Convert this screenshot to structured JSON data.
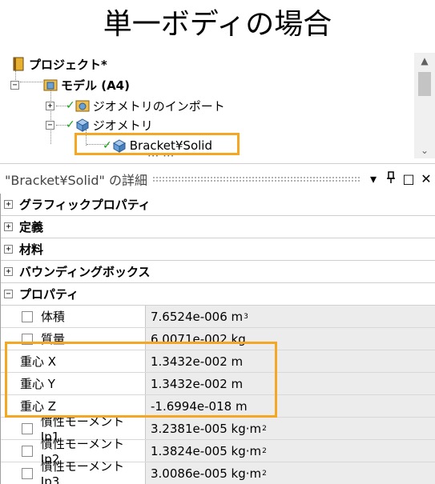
{
  "page_title": "単一ボディの場合",
  "tree": {
    "project": "プロジェクト*",
    "model": "モデル (A4)",
    "geometry_import": "ジオメトリのインポート",
    "geometry": "ジオメトリ",
    "body": "Bracket¥Solid",
    "partial_next": "··· ···"
  },
  "details": {
    "title": "\"Bracket¥Solid\" の詳細",
    "buttons": {
      "dropdown": "▾",
      "pin": "ᛘ",
      "maximize": "□",
      "close": "✕"
    }
  },
  "categories": [
    {
      "label": "グラフィックプロパティ",
      "toggle": "+"
    },
    {
      "label": "定義",
      "toggle": "+"
    },
    {
      "label": "材料",
      "toggle": "+"
    },
    {
      "label": "バウンディングボックス",
      "toggle": "+"
    },
    {
      "label": "プロパティ",
      "toggle": "−"
    }
  ],
  "properties": [
    {
      "name": "体積",
      "value": "7.6524e-006 m",
      "sup": "3",
      "checkbox": true
    },
    {
      "name": "質量",
      "value": "6.0071e-002 kg",
      "sup": "",
      "checkbox": true
    },
    {
      "name": "重心 X",
      "value": "1.3432e-002 m",
      "sup": "",
      "checkbox": false
    },
    {
      "name": "重心 Y",
      "value": "1.3432e-002 m",
      "sup": "",
      "checkbox": false
    },
    {
      "name": "重心 Z",
      "value": "-1.6994e-018 m",
      "sup": "",
      "checkbox": false
    },
    {
      "name": "慣性モーメント Ip1",
      "value": "3.2381e-005 kg·m",
      "sup": "2",
      "checkbox": true
    },
    {
      "name": "慣性モーメント Ip2",
      "value": "1.3824e-005 kg·m",
      "sup": "2",
      "checkbox": true
    },
    {
      "name": "慣性モーメント Ip3",
      "value": "3.0086e-005 kg·m",
      "sup": "2",
      "checkbox": true
    }
  ],
  "colors": {
    "highlight": "#f5a623",
    "check": "#18a318",
    "value_bg": "#ececec"
  }
}
